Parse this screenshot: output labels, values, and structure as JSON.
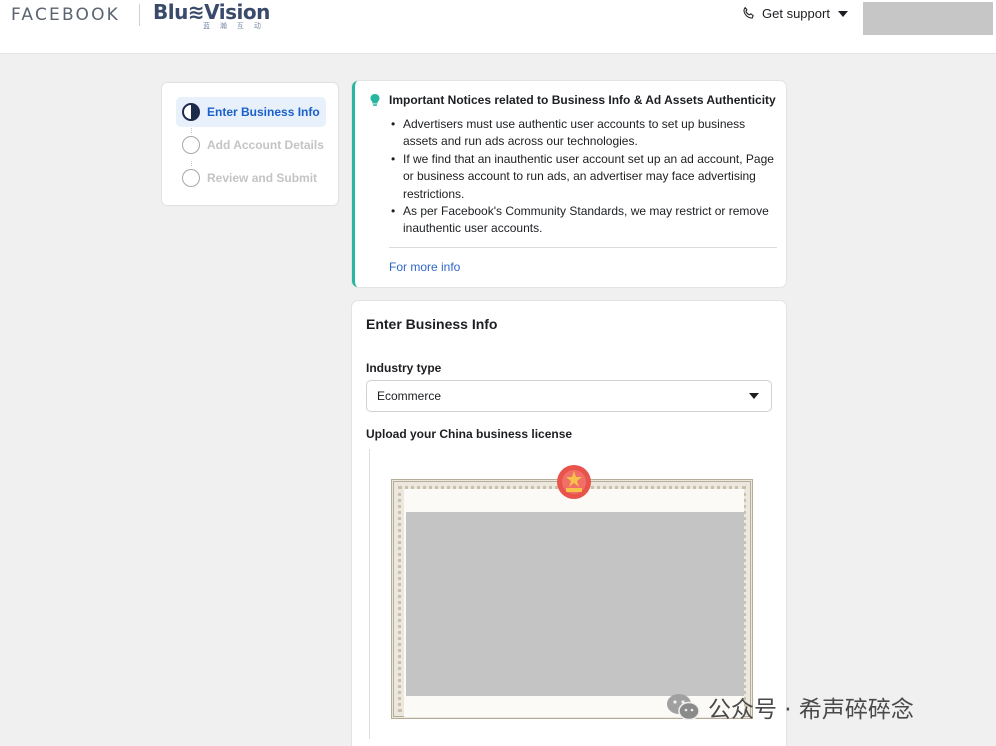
{
  "header": {
    "facebook_logo": "FACEBOOK",
    "partner_logo": "Blu≋Vision",
    "partner_logo_sub": "蓝 瀚 互 动",
    "support_label": "Get support"
  },
  "steps": [
    {
      "label": "Enter Business Info",
      "state": "active"
    },
    {
      "label": "Add Account Details",
      "state": "pending"
    },
    {
      "label": "Review and Submit",
      "state": "pending"
    }
  ],
  "notice": {
    "title": "Important Notices related to Business Info & Ad Assets Authenticity",
    "items": [
      "Advertisers must use authentic user accounts to set up business assets and run ads across our technologies.",
      "If we find that an inauthentic user account set up an ad account, Page or business account to run ads, an advertiser may face advertising restrictions.",
      "As per Facebook's Community Standards, we may restrict or remove inauthentic user accounts."
    ],
    "link": "For more info"
  },
  "business_info": {
    "title": "Enter Business Info",
    "industry_label": "Industry type",
    "industry_value": "Ecommerce",
    "upload_label": "Upload your China business license"
  },
  "watermark": {
    "text": "公众号 · 希声碎碎念"
  },
  "colors": {
    "accent_blue": "#1b60c8",
    "notice_border": "#27b6a0",
    "link": "#2e67c8",
    "page_bg": "#f0f0f0"
  }
}
